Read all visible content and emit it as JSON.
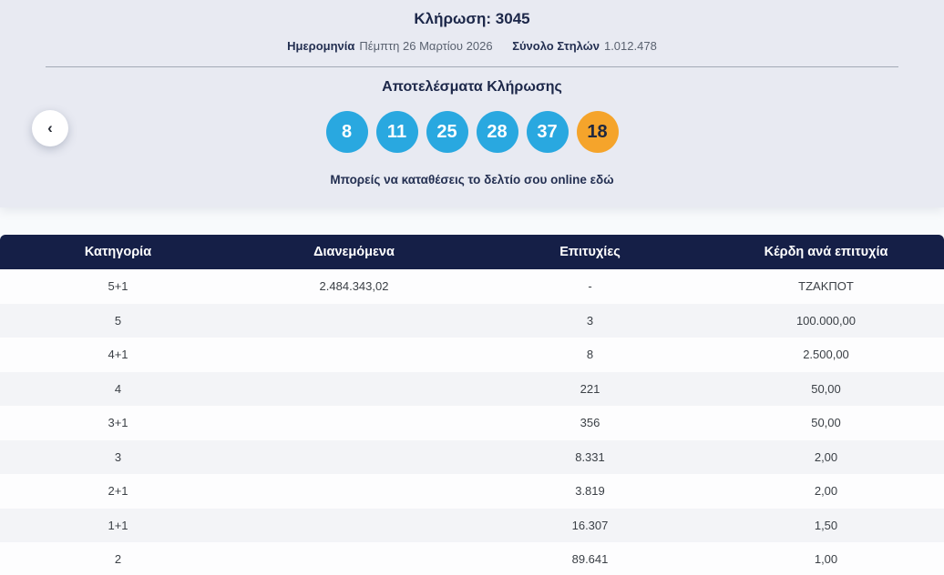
{
  "draw": {
    "title": "Κλήρωση: 3045",
    "date_label": "Ημερομηνία",
    "date_value": "Πέμπτη 26 Μαρτίου 2026",
    "columns_label": "Σύνολο Στηλών",
    "columns_value": "1.012.478"
  },
  "results": {
    "heading": "Αποτελέσματα Κλήρωσης",
    "numbers": [
      "8",
      "11",
      "25",
      "28",
      "37"
    ],
    "bonus": "18",
    "cta": "Μπορείς να καταθέσεις το δελτίο σου online εδώ",
    "prev_icon": "‹"
  },
  "table": {
    "headers": [
      "Κατηγορία",
      "Διανεμόμενα",
      "Επιτυχίες",
      "Κέρδη ανά επιτυχία"
    ],
    "rows": [
      {
        "category": "5+1",
        "distributed": "2.484.343,02",
        "winners": "-",
        "prize": "ΤΖΑΚΠΟΤ"
      },
      {
        "category": "5",
        "distributed": "",
        "winners": "3",
        "prize": "100.000,00"
      },
      {
        "category": "4+1",
        "distributed": "",
        "winners": "8",
        "prize": "2.500,00"
      },
      {
        "category": "4",
        "distributed": "",
        "winners": "221",
        "prize": "50,00"
      },
      {
        "category": "3+1",
        "distributed": "",
        "winners": "356",
        "prize": "50,00"
      },
      {
        "category": "3",
        "distributed": "",
        "winners": "8.331",
        "prize": "2,00"
      },
      {
        "category": "2+1",
        "distributed": "",
        "winners": "3.819",
        "prize": "2,00"
      },
      {
        "category": "1+1",
        "distributed": "",
        "winners": "16.307",
        "prize": "1,50"
      },
      {
        "category": "2",
        "distributed": "",
        "winners": "89.641",
        "prize": "1,00"
      }
    ]
  },
  "colors": {
    "ball_blue": "#29a8e0",
    "ball_orange": "#f5a42b",
    "header_navy": "#151f47",
    "panel_bg": "#e8eaf2"
  }
}
